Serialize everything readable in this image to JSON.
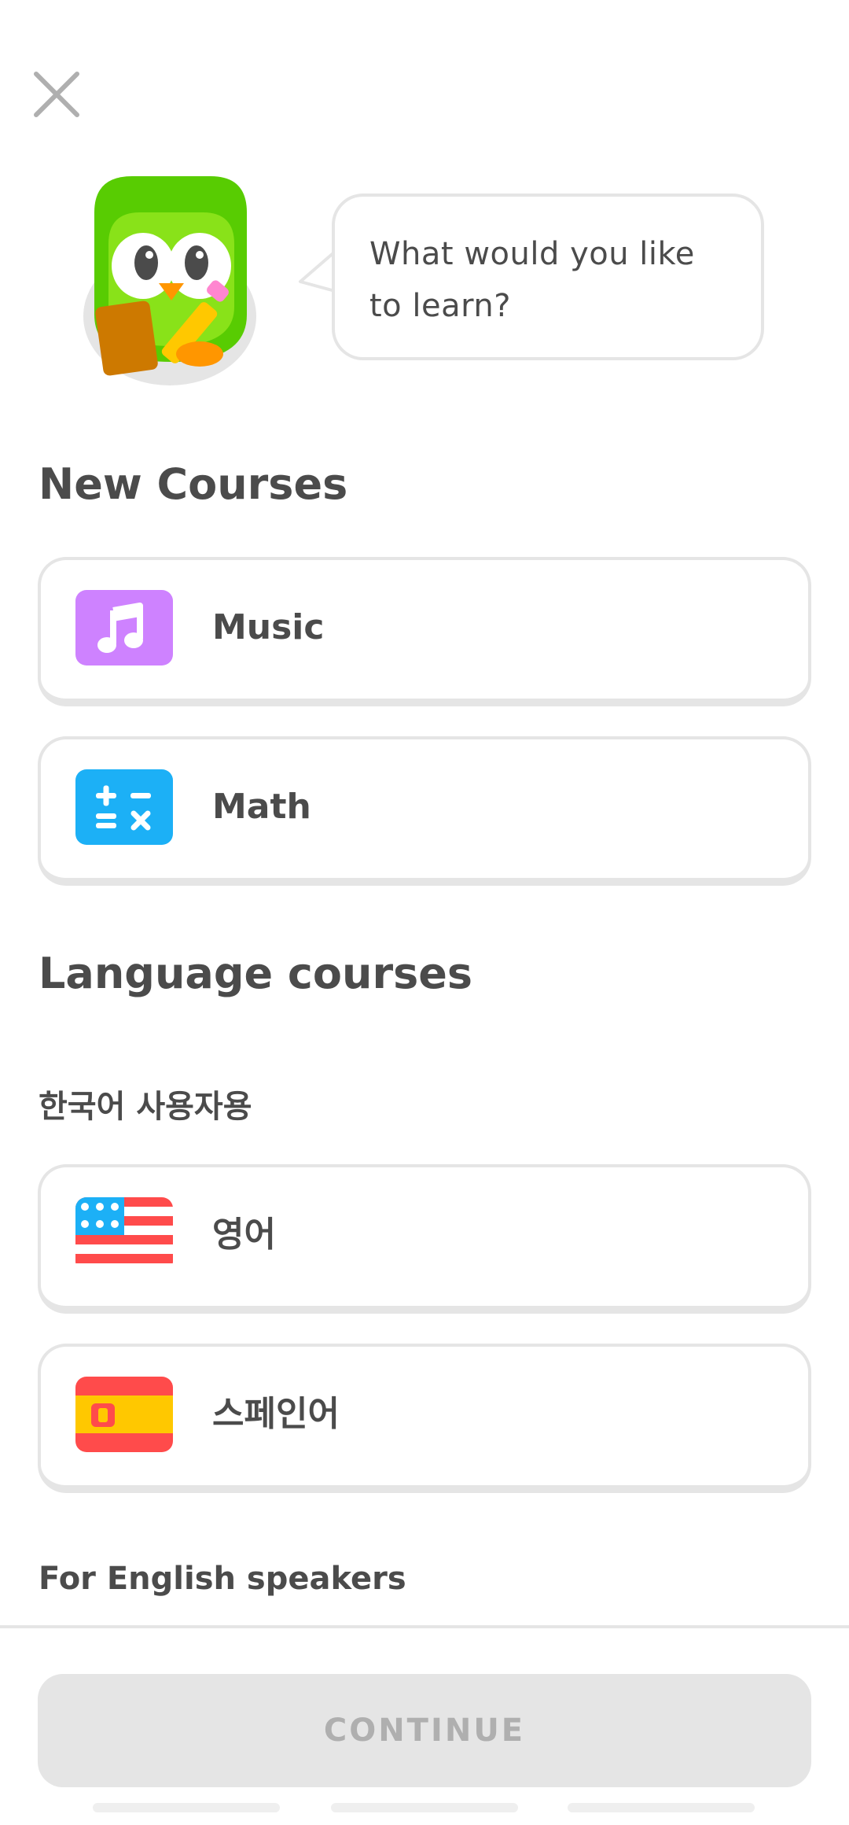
{
  "header": {
    "close_icon": "close-icon"
  },
  "mascot": {
    "icon": "owl-mascot-icon"
  },
  "speech_bubble": {
    "text": "What would you like to learn?"
  },
  "new_courses": {
    "title": "New Courses",
    "items": [
      {
        "label": "Music",
        "icon": "music-note-icon",
        "icon_color": "#ce82ff"
      },
      {
        "label": "Math",
        "icon": "math-symbols-icon",
        "icon_color": "#1cb0f6"
      }
    ]
  },
  "language_courses": {
    "title": "Language courses",
    "groups": [
      {
        "heading": "한국어 사용자용",
        "items": [
          {
            "label": "영어",
            "icon": "us-flag-icon"
          },
          {
            "label": "스페인어",
            "icon": "spain-flag-icon"
          }
        ]
      },
      {
        "heading": "For English speakers",
        "items": []
      }
    ]
  },
  "footer": {
    "continue_label": "CONTINUE"
  },
  "colors": {
    "border": "#e5e5e5",
    "text": "#4b4b4b",
    "disabled_button": "#e5e5e5",
    "disabled_text": "#afafaf",
    "owl_green": "#58cc02"
  }
}
